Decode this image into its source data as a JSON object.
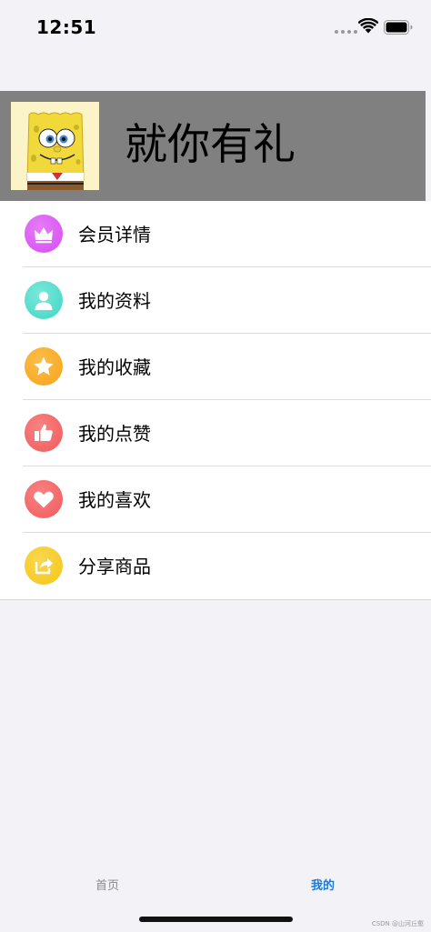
{
  "status_bar": {
    "time": "12:51"
  },
  "header": {
    "title": "就你有礼",
    "background": "#808080"
  },
  "menu": {
    "items": [
      {
        "label": "会员详情",
        "icon": "crown-icon",
        "color": "#d54bf2"
      },
      {
        "label": "我的资料",
        "icon": "user-icon",
        "color": "#3fd6c4"
      },
      {
        "label": "我的收藏",
        "icon": "star-icon",
        "color": "#f7a21b"
      },
      {
        "label": "我的点赞",
        "icon": "thumbs-up-icon",
        "color": "#f2595a"
      },
      {
        "label": "我的喜欢",
        "icon": "heart-icon",
        "color": "#f2595a"
      },
      {
        "label": "分享商品",
        "icon": "share-icon",
        "color": "#f5c517"
      }
    ]
  },
  "tab_bar": {
    "tabs": [
      {
        "label": "首页",
        "active": false
      },
      {
        "label": "我的",
        "active": true
      }
    ],
    "active_color": "#1a7bd9",
    "inactive_color": "#8a8a8e"
  },
  "watermark": "CSDN @山河丘壑"
}
